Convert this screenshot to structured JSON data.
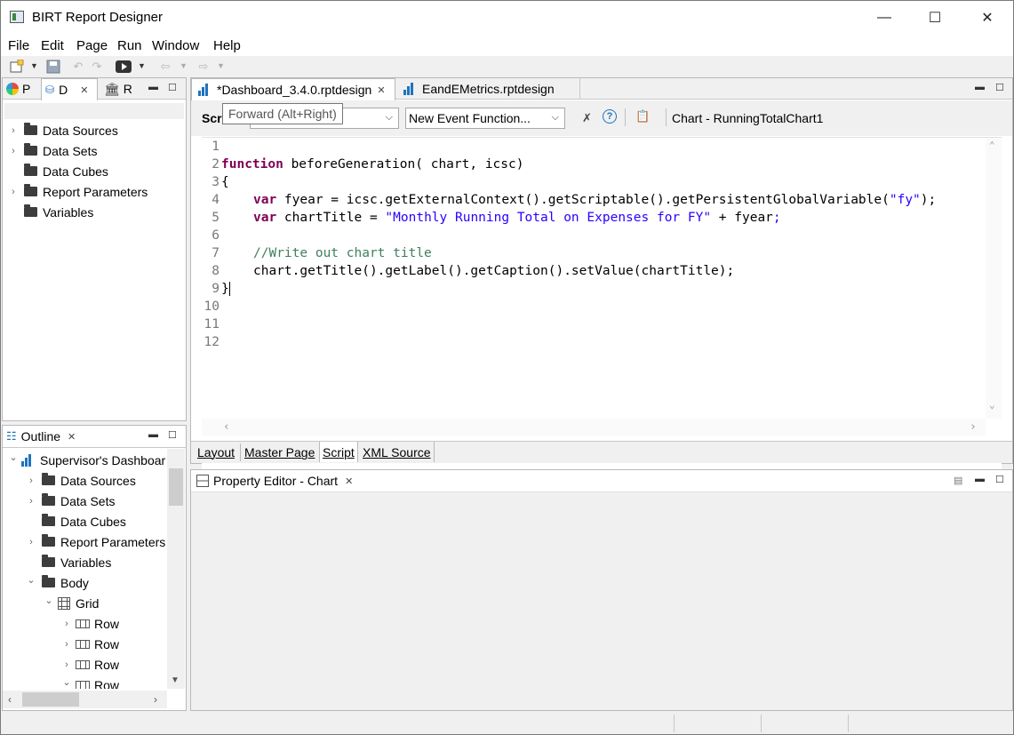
{
  "window": {
    "title": "BIRT Report Designer",
    "minimize_glyph": "—",
    "maximize_glyph": "☐",
    "close_glyph": "✕"
  },
  "menubar": [
    "File",
    "Edit",
    "Page",
    "Run",
    "Window",
    "Help"
  ],
  "left_top_panel": {
    "tabs": [
      "P",
      "D",
      "R"
    ],
    "tree": [
      "Data Sources",
      "Data Sets",
      "Data Cubes",
      "Report Parameters",
      "Variables"
    ]
  },
  "outline": {
    "title": "Outline",
    "tree": [
      {
        "label": "Supervisor's Dashboar",
        "indent": 0,
        "chev": "v",
        "icon": "report"
      },
      {
        "label": "Data Sources",
        "indent": 1,
        "chev": ">",
        "icon": "folder"
      },
      {
        "label": "Data Sets",
        "indent": 1,
        "chev": ">",
        "icon": "folder"
      },
      {
        "label": "Data Cubes",
        "indent": 1,
        "chev": "",
        "icon": "folder"
      },
      {
        "label": "Report Parameters",
        "indent": 1,
        "chev": ">",
        "icon": "folder"
      },
      {
        "label": "Variables",
        "indent": 1,
        "chev": "",
        "icon": "folder"
      },
      {
        "label": "Body",
        "indent": 1,
        "chev": "v",
        "icon": "folder"
      },
      {
        "label": "Grid",
        "indent": 2,
        "chev": "v",
        "icon": "grid"
      },
      {
        "label": "Row",
        "indent": 3,
        "chev": ">",
        "icon": "row"
      },
      {
        "label": "Row",
        "indent": 3,
        "chev": ">",
        "icon": "row"
      },
      {
        "label": "Row",
        "indent": 3,
        "chev": ">",
        "icon": "row"
      },
      {
        "label": "Row",
        "indent": 3,
        "chev": "v",
        "icon": "row"
      }
    ]
  },
  "editor": {
    "tabs": [
      {
        "label": "*Dashboard_3.4.0.rptdesign",
        "active": true
      },
      {
        "label": "EandEMetrics.rptdesign",
        "active": false
      }
    ],
    "script_label": "Scr",
    "tooltip": "Forward (Alt+Right)",
    "event_combo": "New Event Function...",
    "context_label": "Chart - RunningTotalChart1",
    "line_numbers": [
      "1",
      "2",
      "3",
      "4",
      "5",
      "6",
      "7",
      "8",
      "9",
      "10",
      "11",
      "12"
    ],
    "bottom_tabs": [
      "Layout",
      "Master Page",
      "Script",
      "XML Source"
    ]
  },
  "code_tokens": {
    "l2_kw": "function",
    "l2_rest": " beforeGeneration( chart, icsc)",
    "l3": "{",
    "l4_kw": "var",
    "l4_rest": " fyear = icsc.getExternalContext().getScriptable().getPersistentGlobalVariable(",
    "l4_str": "\"fy\"",
    "l4_end": ");",
    "l5_kw": "var",
    "l5_rest": " chartTitle = ",
    "l5_str": "\"Monthly Running Total on Expenses for FY\"",
    "l5_plus": " + fyear",
    "l5_end": ";",
    "l7_cmt": "//Write out chart title",
    "l8": "chart.getTitle().getLabel().getCaption().setValue(chartTitle);",
    "l9": "}"
  },
  "property_editor": {
    "title": "Property Editor - Chart"
  },
  "colors": {
    "keyword": "#7f0055",
    "string": "#2a00ff",
    "comment": "#3f7f5f"
  }
}
